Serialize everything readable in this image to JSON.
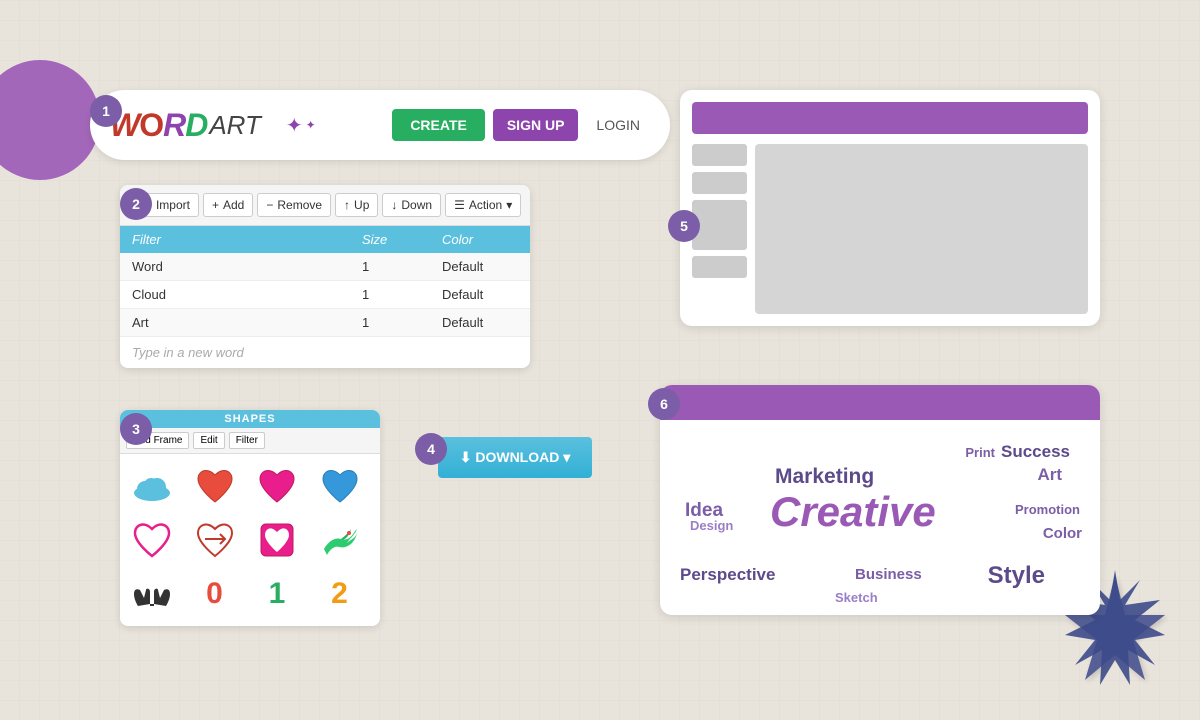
{
  "background": {
    "color": "#e8e4dc"
  },
  "step1": {
    "badge": "1",
    "logo": {
      "w": "W",
      "o": "O",
      "r": "R",
      "d": "D",
      "art": "ART"
    },
    "buttons": {
      "create": "CREATE",
      "signup": "SIGN UP",
      "login": "LOGIN"
    }
  },
  "step2": {
    "badge": "2",
    "toolbar": {
      "import": "Import",
      "add": "Add",
      "remove": "Remove",
      "up": "Up",
      "down": "Down",
      "action": "Action"
    },
    "table": {
      "headers": [
        "Filter",
        "Size",
        "Color"
      ],
      "rows": [
        {
          "word": "Word",
          "size": "1",
          "color": "Default"
        },
        {
          "word": "Cloud",
          "size": "1",
          "color": "Default"
        },
        {
          "word": "Art",
          "size": "1",
          "color": "Default"
        }
      ],
      "placeholder": "Type in a new word"
    }
  },
  "step3": {
    "badge": "3",
    "title": "SHAPES",
    "toolbar": {
      "addFrame": "Add Frame",
      "edit": "Edit",
      "filter": "Filter"
    },
    "shapes": [
      "☁",
      "❤",
      "💗",
      "💙",
      "🩷",
      "❤",
      "🟥",
      "🌿",
      "🤲",
      "0",
      "1",
      "2"
    ]
  },
  "step4": {
    "badge": "4",
    "download_label": "⬇ DOWNLOAD ▾"
  },
  "step5": {
    "badge": "5"
  },
  "step6": {
    "badge": "6",
    "words": [
      {
        "text": "Print",
        "size": 13,
        "color": "#7b5ea7"
      },
      {
        "text": "Success",
        "size": 16,
        "color": "#5d4a8a"
      },
      {
        "text": "Marketing",
        "size": 20,
        "color": "#5d4a8a"
      },
      {
        "text": "Art",
        "size": 16,
        "color": "#7b5ea7"
      },
      {
        "text": "Idea",
        "size": 18,
        "color": "#7b5ea7"
      },
      {
        "text": "Design",
        "size": 13,
        "color": "#9b7ec8"
      },
      {
        "text": "Creative",
        "size": 38,
        "color": "#9b59b6"
      },
      {
        "text": "Promotion",
        "size": 13,
        "color": "#7b5ea7"
      },
      {
        "text": "Color",
        "size": 15,
        "color": "#7b5ea7"
      },
      {
        "text": "Perspective",
        "size": 17,
        "color": "#5d4a8a"
      },
      {
        "text": "Business",
        "size": 15,
        "color": "#7b5ea7"
      },
      {
        "text": "Style",
        "size": 22,
        "color": "#5d4a8a"
      },
      {
        "text": "Sketch",
        "size": 13,
        "color": "#9b7ec8"
      }
    ]
  }
}
